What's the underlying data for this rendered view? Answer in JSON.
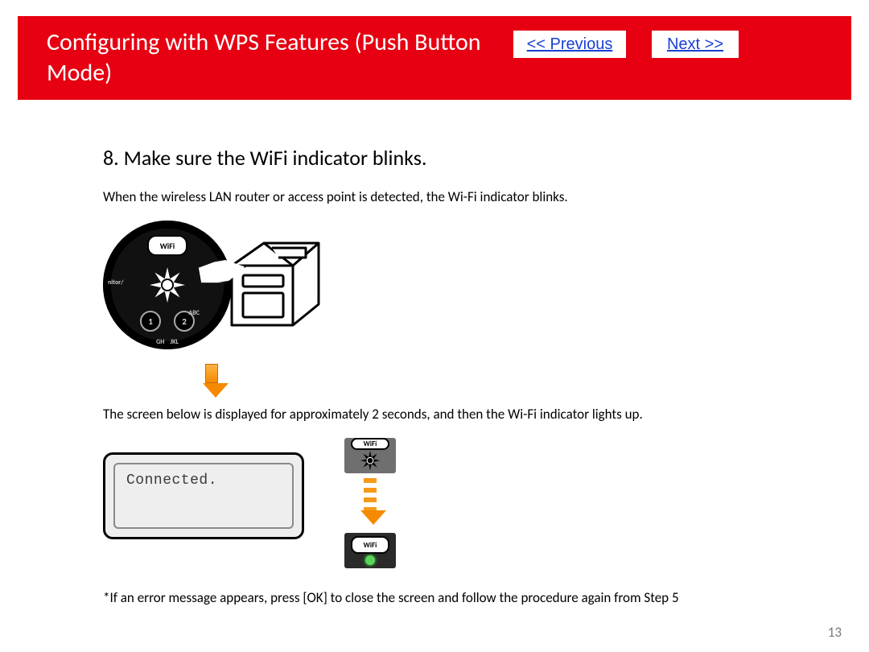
{
  "header": {
    "title": "Configuring with WPS Features (Push Button Mode)",
    "prev_label": "<< Previous",
    "next_label": "Next >>"
  },
  "step": {
    "heading": "8. Make sure the WiFi indicator blinks.",
    "p1": "When the wireless LAN router or access point is detected, the Wi-Fi indicator blinks.",
    "p2": "The screen below is displayed for approximately 2 seconds, and then the Wi-Fi indicator lights up.",
    "note": "*If an error message appears, press [OK] to close the screen and follow the procedure again from Step 5"
  },
  "dial": {
    "wifi_label": "WiFi",
    "btn1": "1",
    "btn2": "2",
    "edge_left": "nitor/",
    "edge_abc": "ABC",
    "edge_gh": "GH",
    "edge_jkl": "JKL"
  },
  "lcd": {
    "text": "Connected."
  },
  "chip": {
    "wifi_label": "WiFi"
  },
  "page_number": "13"
}
